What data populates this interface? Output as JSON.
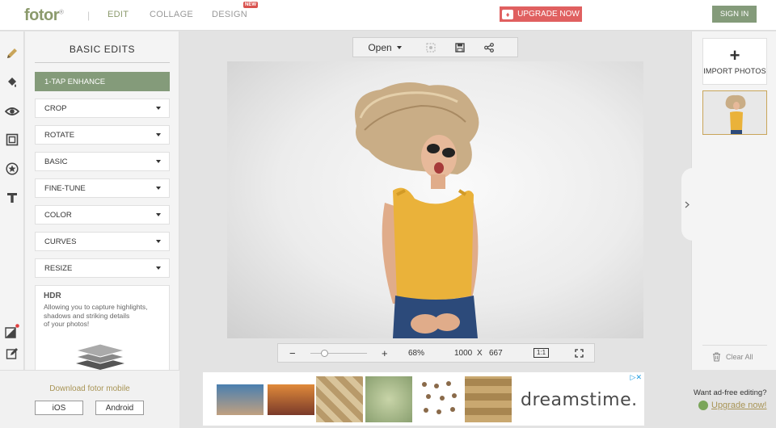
{
  "header": {
    "logo": "fotor",
    "logo_mark": "®",
    "separator": "|",
    "tabs": [
      {
        "label": "EDIT",
        "active": true
      },
      {
        "label": "COLLAGE",
        "active": false
      },
      {
        "label": "DESIGN",
        "active": false
      }
    ],
    "new_badge": "NEW",
    "upgrade_label": "UPGRADE NOW",
    "signin_label": "SIGN IN"
  },
  "left_rail": {
    "icons": [
      "pencil-icon",
      "bucket-icon",
      "eye-icon",
      "frame-icon",
      "sticker-icon",
      "text-icon",
      "corner-icon",
      "edit-note-icon"
    ]
  },
  "panel": {
    "title": "BASIC EDITS",
    "enhance_label": "1-TAP ENHANCE",
    "items": [
      "CROP",
      "ROTATE",
      "BASIC",
      "FINE-TUNE",
      "COLOR",
      "CURVES",
      "RESIZE"
    ],
    "hdr": {
      "title": "HDR",
      "description_lines": [
        "Allowing you to capture highlights,",
        "shadows and striking details",
        "of your photos!"
      ]
    }
  },
  "toolbar": {
    "open_label": "Open",
    "icons": [
      "compare-icon",
      "save-icon",
      "share-icon"
    ]
  },
  "zoom": {
    "minus": "−",
    "plus": "+",
    "level": "68%",
    "width": "1000",
    "times": "X",
    "height": "667",
    "one_to_one": "1:1",
    "zoom_fraction": 0.25
  },
  "right_panel": {
    "import_plus": "+",
    "import_label": "IMPORT PHOTOS",
    "clear_label": "Clear All"
  },
  "bottom": {
    "download_text": "Download fotor mobile",
    "ios_label": "iOS",
    "android_label": "Android",
    "ad_brand": "dreamstime.",
    "adfree_text": "Want ad-free editing?",
    "adfree_link": "Upgrade now!"
  },
  "colors": {
    "accent_green": "#849b7a",
    "upgrade_red": "#e06060",
    "gold": "#a89455"
  }
}
